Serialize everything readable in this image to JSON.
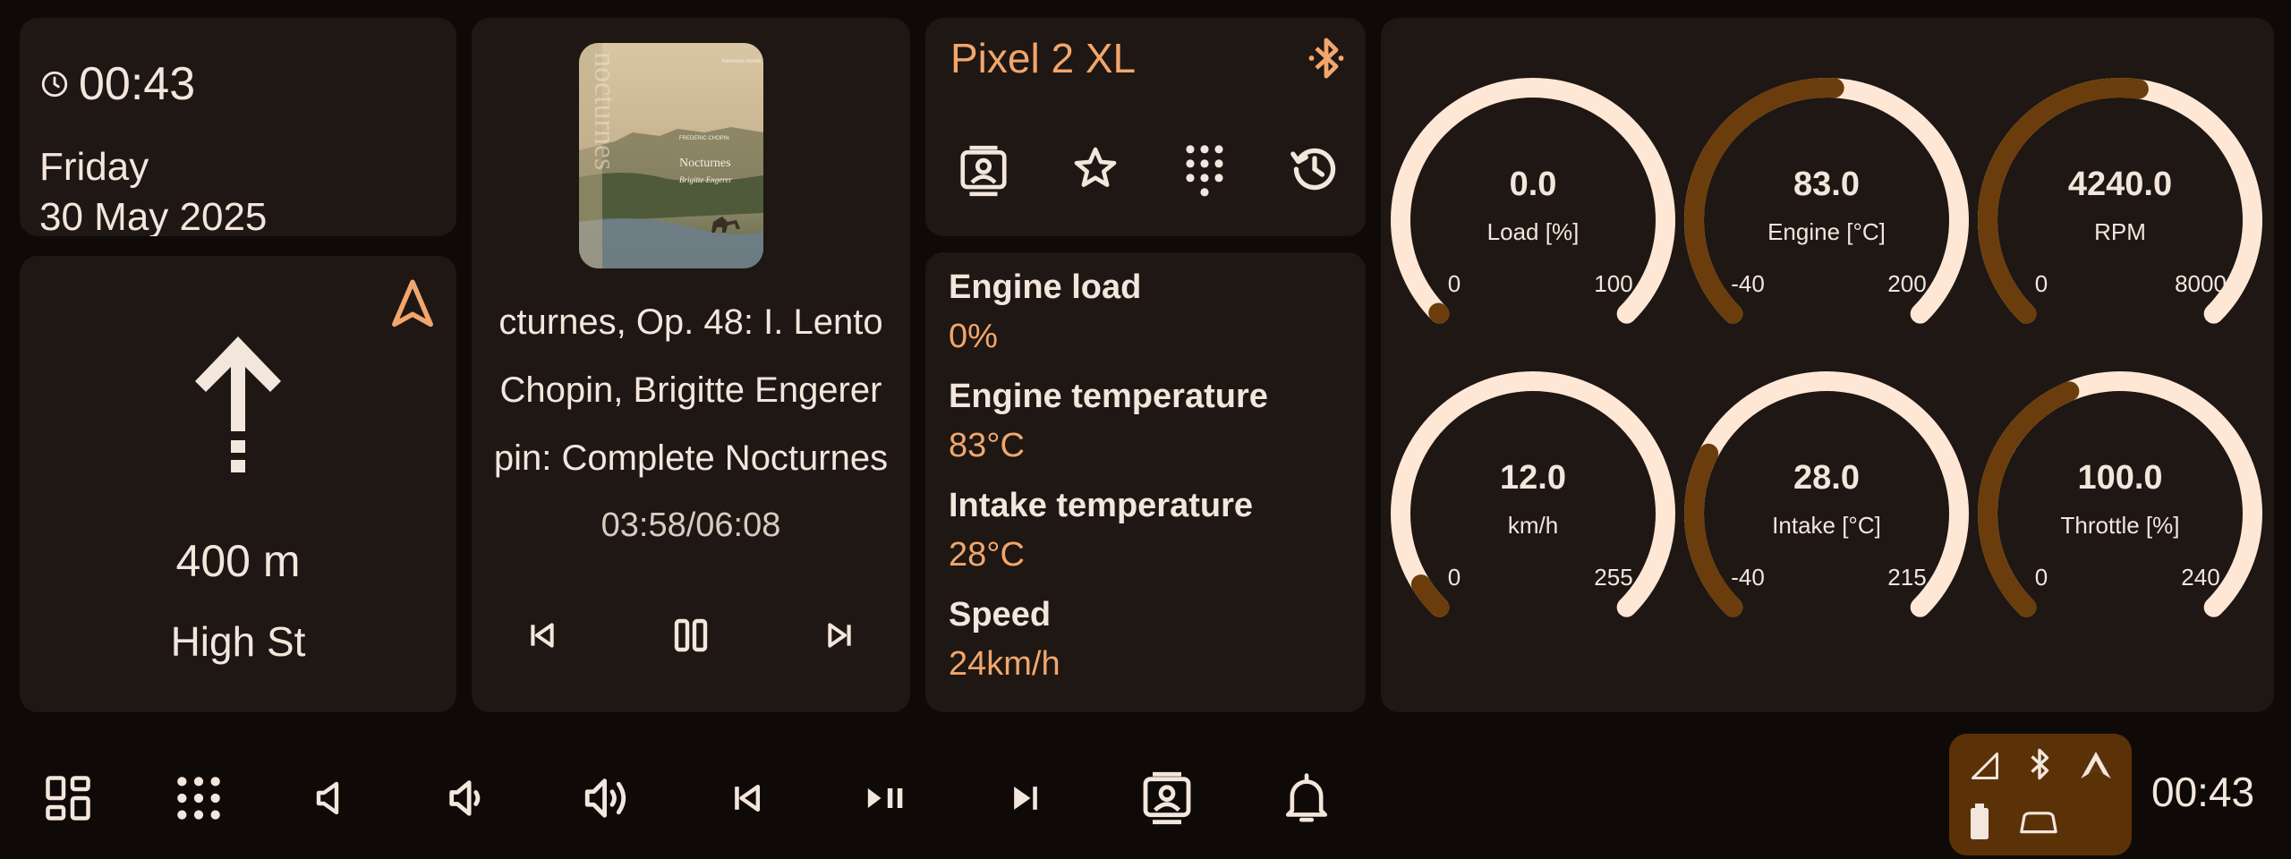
{
  "clock": {
    "time": "00:43",
    "day": "Friday",
    "date": "30 May 2025",
    "icon": "clock-icon"
  },
  "navigation": {
    "distance": "400 m",
    "street": "High St",
    "arrow_icon": "straight-arrow-icon",
    "nav_icon": "navigation-icon"
  },
  "media": {
    "title": "cturnes, Op. 48: I. Lento",
    "artist": "Chopin, Brigitte Engerer",
    "album": "pin: Complete Nocturnes",
    "progress": "03:58/06:08",
    "album_art_text": [
      "harmonia mundi",
      "Nocturnes",
      "Brigitte Engerer",
      "FREDERIC CHOPIN",
      "nocturnes"
    ],
    "controls": [
      "previous-icon",
      "pause-icon",
      "next-icon"
    ]
  },
  "phone": {
    "name": "Pixel 2 XL",
    "actions": [
      "contacts-icon",
      "star-icon",
      "dialpad-icon",
      "history-icon"
    ]
  },
  "stats": [
    {
      "label": "Engine load",
      "value": "0%"
    },
    {
      "label": "Engine temperature",
      "value": "83°C"
    },
    {
      "label": "Intake temperature",
      "value": "28°C"
    },
    {
      "label": "Speed",
      "value": "24km/h"
    }
  ],
  "gauges": [
    {
      "value": 0.0,
      "display": "0.0",
      "label": "Load [%]",
      "min": 0,
      "max": 100,
      "min_label": "0",
      "max_label": "100"
    },
    {
      "value": 83.0,
      "display": "83.0",
      "label": "Engine [°C]",
      "min": -40,
      "max": 200,
      "min_label": "-40",
      "max_label": "200"
    },
    {
      "value": 4240.0,
      "display": "4240.0",
      "label": "RPM",
      "min": 0,
      "max": 8000,
      "min_label": "0",
      "max_label": "8000"
    },
    {
      "value": 12.0,
      "display": "12.0",
      "label": "km/h",
      "min": 0,
      "max": 255,
      "min_label": "0",
      "max_label": "255"
    },
    {
      "value": 28.0,
      "display": "28.0",
      "label": "Intake [°C]",
      "min": -40,
      "max": 215,
      "min_label": "-40",
      "max_label": "215"
    },
    {
      "value": 100.0,
      "display": "100.0",
      "label": "Throttle [%]",
      "min": 0,
      "max": 240,
      "min_label": "0",
      "max_label": "240"
    }
  ],
  "bottom_bar": {
    "buttons": [
      "dashboard-icon",
      "apps-grid-icon",
      "volume-mute-icon",
      "volume-down-icon",
      "volume-up-icon",
      "skip-previous-icon",
      "play-pause-icon",
      "skip-next-icon",
      "contacts-icon",
      "notifications-icon"
    ],
    "status_icons": [
      "signal-icon",
      "bluetooth-icon",
      "app-logo-icon",
      "battery-icon",
      "car-icon"
    ],
    "clock": "00:43"
  },
  "colors": {
    "background": "#0f0a07",
    "card": "#1e1713",
    "accent": "#f2a66c",
    "cream": "#f3e6dc",
    "gauge_track": "#ffe7d6",
    "gauge_fill": "#6b3d0c",
    "status_pill": "#5b3208"
  }
}
